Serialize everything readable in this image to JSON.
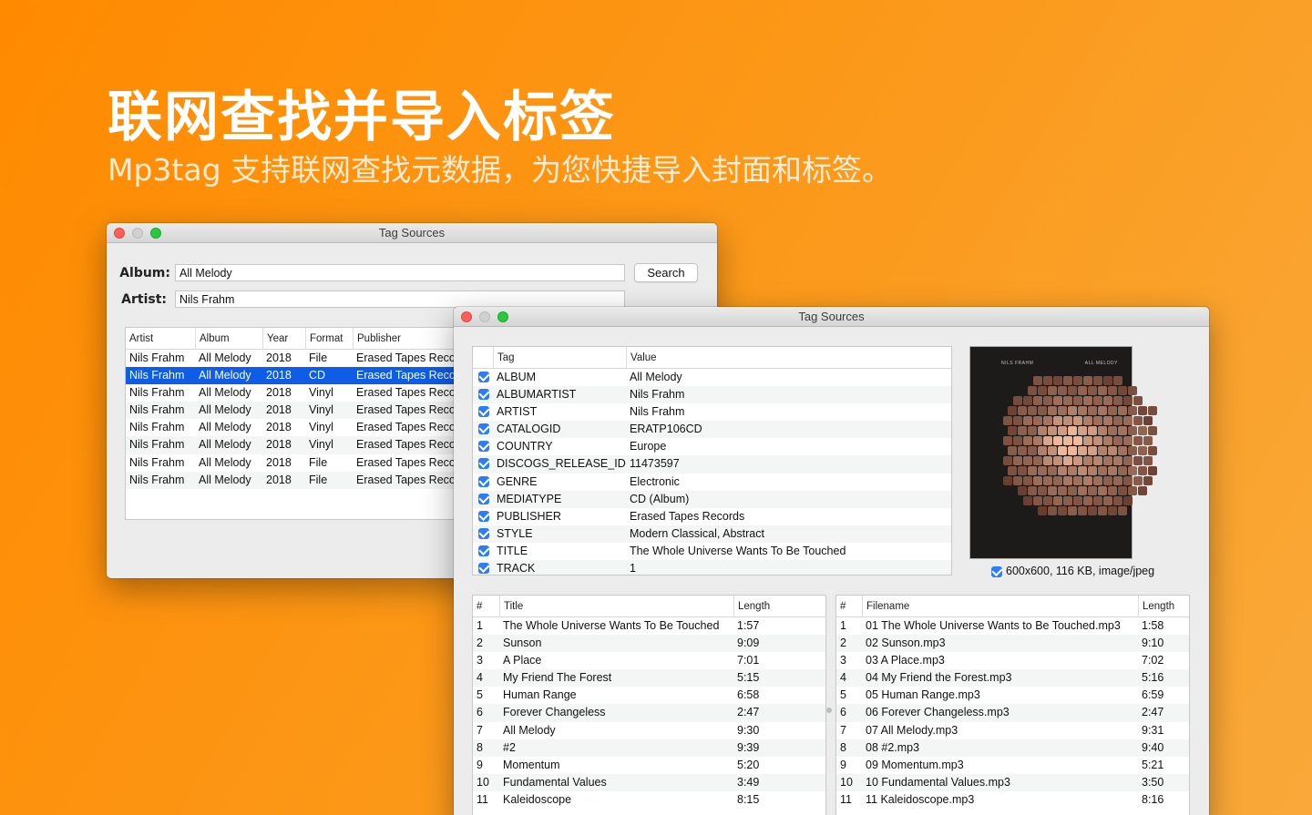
{
  "promo": {
    "headline": "联网查找并导入标签",
    "subline": "Mp3tag 支持联网查找元数据，为您快捷导入封面和标签。"
  },
  "colors": {
    "background": "#ff8a00",
    "selection": "#0f5ce6",
    "checkbox": "#2e7cf6"
  },
  "search_window": {
    "title": "Tag Sources",
    "album_label": "Album:",
    "album_value": "All Melody",
    "artist_label": "Artist:",
    "artist_value": "Nils Frahm",
    "search_button": "Search",
    "columns": [
      "Artist",
      "Album",
      "Year",
      "Format",
      "Publisher"
    ],
    "rows": [
      [
        "Nils Frahm",
        "All Melody",
        "2018",
        "File",
        "Erased Tapes Recor"
      ],
      [
        "Nils Frahm",
        "All Melody",
        "2018",
        "CD",
        "Erased Tapes Recor"
      ],
      [
        "Nils Frahm",
        "All Melody",
        "2018",
        "Vinyl",
        "Erased Tapes Recor"
      ],
      [
        "Nils Frahm",
        "All Melody",
        "2018",
        "Vinyl",
        "Erased Tapes Recor"
      ],
      [
        "Nils Frahm",
        "All Melody",
        "2018",
        "Vinyl",
        "Erased Tapes Recor"
      ],
      [
        "Nils Frahm",
        "All Melody",
        "2018",
        "Vinyl",
        "Erased Tapes Recor"
      ],
      [
        "Nils Frahm",
        "All Melody",
        "2018",
        "File",
        "Erased Tapes Recor"
      ],
      [
        "Nils Frahm",
        "All Melody",
        "2018",
        "File",
        "Erased Tapes Recor"
      ]
    ],
    "selected_row": 1
  },
  "tags_window": {
    "title": "Tag Sources",
    "tag_columns": [
      "Tag",
      "Value"
    ],
    "tags": [
      [
        "ALBUM",
        "All Melody"
      ],
      [
        "ALBUMARTIST",
        "Nils Frahm"
      ],
      [
        "ARTIST",
        "Nils Frahm"
      ],
      [
        "CATALOGID",
        "ERATP106CD"
      ],
      [
        "COUNTRY",
        "Europe"
      ],
      [
        "DISCOGS_RELEASE_ID",
        "11473597"
      ],
      [
        "GENRE",
        "Electronic"
      ],
      [
        "MEDIATYPE",
        "CD (Album)"
      ],
      [
        "PUBLISHER",
        "Erased Tapes Records"
      ],
      [
        "STYLE",
        "Modern Classical, Abstract"
      ],
      [
        "TITLE",
        "The Whole Universe Wants To Be Touched"
      ],
      [
        "TRACK",
        "1"
      ]
    ],
    "cover": {
      "top_left_text": "NILS FRAHM",
      "top_right_text": "ALL MELODY",
      "info": "600x600, 116 KB, image/jpeg"
    },
    "track_columns": [
      "#",
      "Title",
      "Length"
    ],
    "tracks": [
      [
        "1",
        "The Whole Universe Wants To Be Touched",
        "1:57"
      ],
      [
        "2",
        "Sunson",
        "9:09"
      ],
      [
        "3",
        "A Place",
        "7:01"
      ],
      [
        "4",
        "My Friend The Forest",
        "5:15"
      ],
      [
        "5",
        "Human Range",
        "6:58"
      ],
      [
        "6",
        "Forever Changeless",
        "2:47"
      ],
      [
        "7",
        "All Melody",
        "9:30"
      ],
      [
        "8",
        "#2",
        "9:39"
      ],
      [
        "9",
        "Momentum",
        "5:20"
      ],
      [
        "10",
        "Fundamental Values",
        "3:49"
      ],
      [
        "11",
        "Kaleidoscope",
        "8:15"
      ]
    ],
    "file_columns": [
      "#",
      "Filename",
      "Length"
    ],
    "files": [
      [
        "1",
        "01 The Whole Universe Wants to Be Touched.mp3",
        "1:58"
      ],
      [
        "2",
        "02 Sunson.mp3",
        "9:10"
      ],
      [
        "3",
        "03 A Place.mp3",
        "7:02"
      ],
      [
        "4",
        "04 My Friend the Forest.mp3",
        "5:16"
      ],
      [
        "5",
        "05 Human Range.mp3",
        "6:59"
      ],
      [
        "6",
        "06 Forever Changeless.mp3",
        "2:47"
      ],
      [
        "7",
        "07 All Melody.mp3",
        "9:31"
      ],
      [
        "8",
        "08 #2.mp3",
        "9:40"
      ],
      [
        "9",
        "09 Momentum.mp3",
        "5:21"
      ],
      [
        "10",
        "10 Fundamental Values.mp3",
        "3:50"
      ],
      [
        "11",
        "11 Kaleidoscope.mp3",
        "8:16"
      ]
    ]
  }
}
